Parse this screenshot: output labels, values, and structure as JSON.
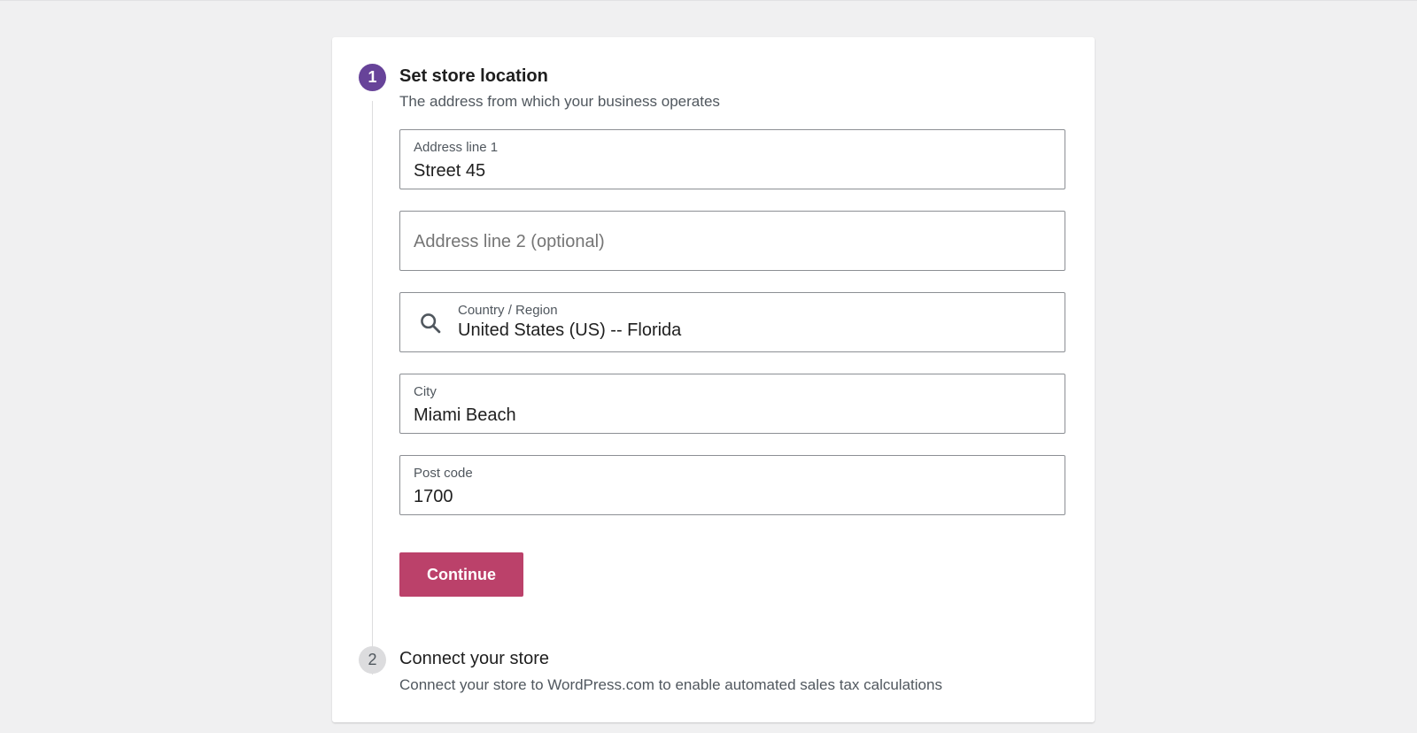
{
  "steps": [
    {
      "number": "1",
      "title": "Set store location",
      "description": "The address from which your business operates",
      "state": "active"
    },
    {
      "number": "2",
      "title": "Connect your store",
      "description": "Connect your store to WordPress.com to enable automated sales tax calculations",
      "state": "inactive"
    }
  ],
  "form": {
    "address1": {
      "label": "Address line 1",
      "value": "Street 45"
    },
    "address2": {
      "placeholder": "Address line 2 (optional)",
      "value": ""
    },
    "country": {
      "label": "Country / Region",
      "value": "United States (US) -- Florida",
      "icon": "search-icon"
    },
    "city": {
      "label": "City",
      "value": "Miami Beach"
    },
    "postcode": {
      "label": "Post code",
      "value": "1700"
    },
    "continue_label": "Continue"
  },
  "colors": {
    "accent_step": "#674399",
    "button": "#bb416a",
    "background": "#f0f0f1"
  }
}
